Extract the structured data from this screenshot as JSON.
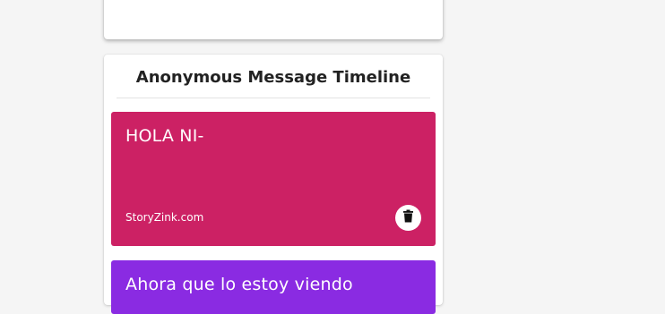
{
  "timeline": {
    "title": "Anonymous Message Timeline"
  },
  "messages": [
    {
      "text": "HOLA NI-",
      "footer": "StoryZink.com",
      "color": "#cc2164",
      "action_icon": "trash-icon"
    },
    {
      "text": "Ahora que lo estoy viendo",
      "color": "#8a2be2"
    }
  ]
}
